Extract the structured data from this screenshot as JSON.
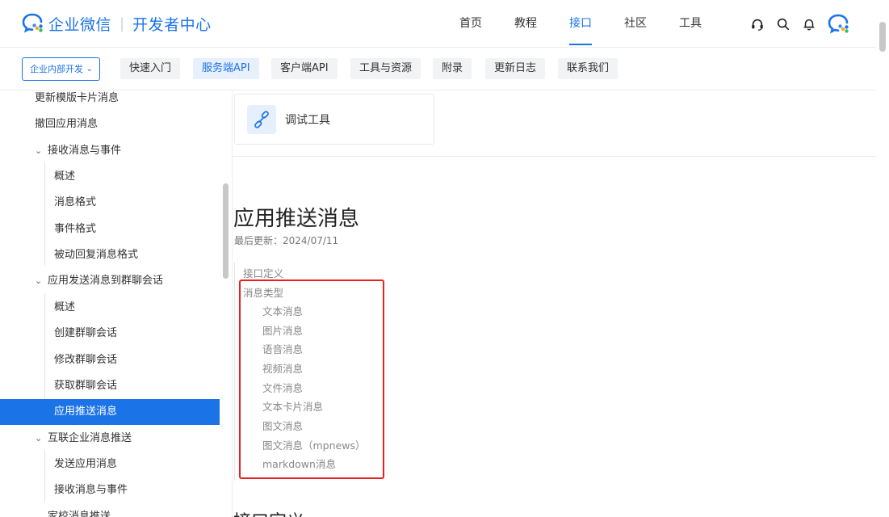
{
  "header": {
    "brand": "企业微信",
    "separator": "|",
    "subtitle": "开发者中心",
    "nav": [
      {
        "label": "首页",
        "active": false
      },
      {
        "label": "教程",
        "active": false
      },
      {
        "label": "接口",
        "active": true
      },
      {
        "label": "社区",
        "active": false
      },
      {
        "label": "工具",
        "active": false
      }
    ],
    "icons": [
      "headset-icon",
      "search-icon",
      "bell-icon",
      "wecom-avatar-icon"
    ]
  },
  "subnav": {
    "select_label": "企业内部开发",
    "pills": [
      {
        "label": "快速入门",
        "active": false
      },
      {
        "label": "服务端API",
        "active": true
      },
      {
        "label": "客户端API",
        "active": false
      },
      {
        "label": "工具与资源",
        "active": false
      },
      {
        "label": "附录",
        "active": false
      },
      {
        "label": "更新日志",
        "active": false
      },
      {
        "label": "联系我们",
        "active": false
      }
    ]
  },
  "sidebar": {
    "items": [
      {
        "label": "更新模版卡片消息",
        "level": 1
      },
      {
        "label": "撤回应用消息",
        "level": 1
      },
      {
        "label": "接收消息与事件",
        "level": 1,
        "expanded": true
      },
      {
        "label": "概述",
        "level": 2
      },
      {
        "label": "消息格式",
        "level": 2
      },
      {
        "label": "事件格式",
        "level": 2
      },
      {
        "label": "被动回复消息格式",
        "level": 2
      },
      {
        "label": "应用发送消息到群聊会话",
        "level": 1,
        "expanded": true
      },
      {
        "label": "概述",
        "level": 2
      },
      {
        "label": "创建群聊会话",
        "level": 2
      },
      {
        "label": "修改群聊会话",
        "level": 2
      },
      {
        "label": "获取群聊会话",
        "level": 2
      },
      {
        "label": "应用推送消息",
        "level": 2,
        "active": true
      },
      {
        "label": "互联企业消息推送",
        "level": 1,
        "expanded": true
      },
      {
        "label": "发送应用消息",
        "level": 2
      },
      {
        "label": "接收消息与事件",
        "level": 2
      },
      {
        "label": "家校消息推送",
        "level": 1,
        "expanded": true
      }
    ]
  },
  "main": {
    "debug_tool_label": "调试工具",
    "title": "应用推送消息",
    "updated": "最后更新：2024/07/11",
    "toc": [
      {
        "label": "接口定义",
        "level": 1
      },
      {
        "label": "消息类型",
        "level": 1
      },
      {
        "label": "文本消息",
        "level": 2
      },
      {
        "label": "图片消息",
        "level": 2
      },
      {
        "label": "语音消息",
        "level": 2
      },
      {
        "label": "视频消息",
        "level": 2
      },
      {
        "label": "文件消息",
        "level": 2
      },
      {
        "label": "文本卡片消息",
        "level": 2
      },
      {
        "label": "图文消息",
        "level": 2
      },
      {
        "label": "图文消息（mpnews）",
        "level": 2
      },
      {
        "label": "markdown消息",
        "level": 2
      }
    ],
    "next_heading": "接口定义"
  },
  "colors": {
    "accent": "#1b73e8",
    "highlight": "#e8201e"
  }
}
